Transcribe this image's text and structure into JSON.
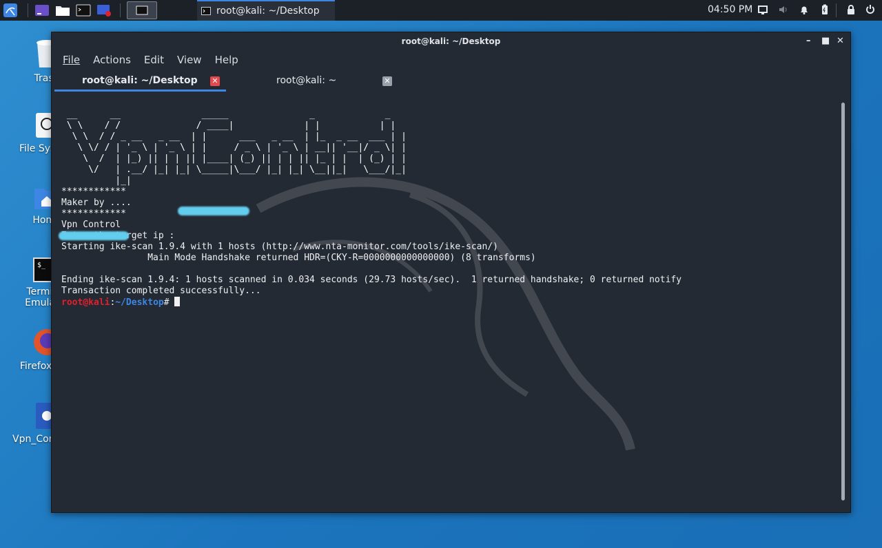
{
  "panel": {
    "task_title": "root@kali: ~/Desktop",
    "clock": "04:50 PM"
  },
  "desktop": {
    "icons": [
      {
        "label": "Trash"
      },
      {
        "label": "File System"
      },
      {
        "label": "Home"
      },
      {
        "label": "Terminal Emulator"
      },
      {
        "label": "Firefox ESR"
      },
      {
        "label": "Vpn_Control.py"
      }
    ]
  },
  "window": {
    "title": "root@kali: ~/Desktop",
    "menu": [
      "File",
      "Actions",
      "Edit",
      "View",
      "Help"
    ],
    "tabs": [
      {
        "label": "root@kali: ~/Desktop",
        "active": true
      },
      {
        "label": "root@kali: ~",
        "active": false
      }
    ]
  },
  "terminal": {
    "ascii_banner": " __      __               _____               _             _ \n \\ \\    / /              / ____|             | |           | |\n  \\ \\  / / _ __   _ __  | |      ___   _ __  | |_  _ __  ___ | |\n   \\ \\/ / | '_ \\ | '_ \\ | |     / _ \\ | '_ \\ | __|| '__|/ _ \\| |\n    \\  /  | |_) || | | || |____| (_) || | | || |_ | |  | (_) | |\n     \\/   | .__/ |_| |_| \\_____|\\___/ |_| |_| \\__||_|   \\___/|_|\n          |_|",
    "lines": [
      "************",
      "Maker by ....",
      "************",
      "Vpn Control",
      "Enter the target ip :",
      "Starting ike-scan 1.9.4 with 1 hosts (http://www.nta-monitor.com/tools/ike-scan/)",
      "                Main Mode Handshake returned HDR=(CKY-R=0000000000000000) (8 transforms)",
      "",
      "Ending ike-scan 1.9.4: 1 hosts scanned in 0.034 seconds (29.73 hosts/sec).  1 returned handshake; 0 returned notify",
      "Transaction completed successfully..."
    ],
    "prompt_user": "root@kali",
    "prompt_colon": ":",
    "prompt_path": "~/Desktop",
    "prompt_symbol": "# "
  },
  "colors": {
    "desktop_bg": "#1b74bd",
    "terminal_bg": "#242a33",
    "accent": "#3d86e3",
    "prompt_user": "#e0202c",
    "tab_close_active": "#e5484d",
    "redaction": "#63cdee"
  }
}
